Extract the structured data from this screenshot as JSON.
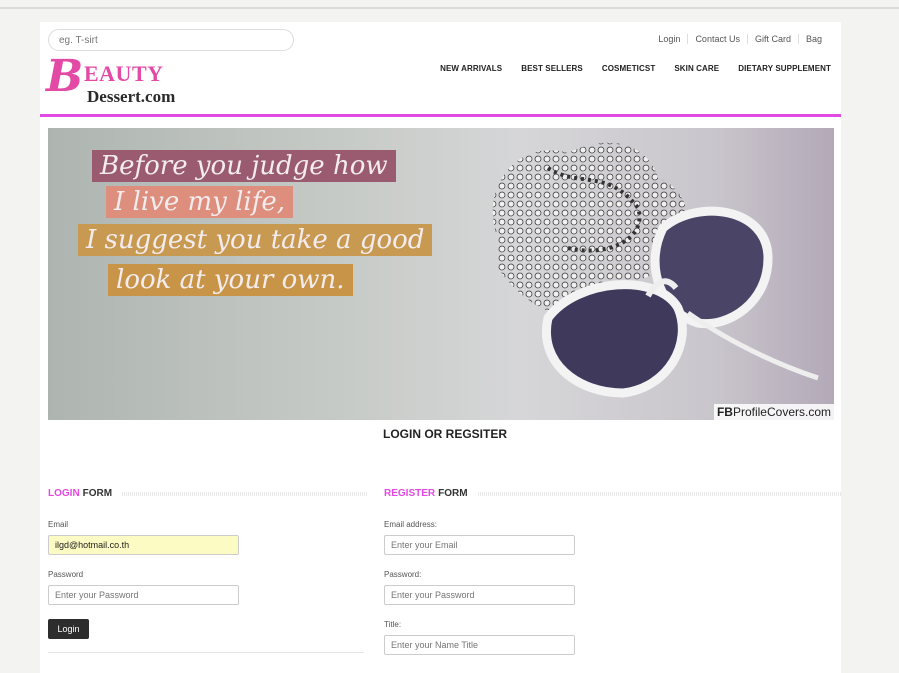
{
  "header": {
    "search_placeholder": "eg. T-sirt",
    "top_links": [
      "Login",
      "Contact Us",
      "Gift Card",
      "Bag"
    ]
  },
  "logo": {
    "initial": "B",
    "rest": "EAUTY",
    "sub": "Dessert.com"
  },
  "nav": [
    "NEW ARRIVALS",
    "BEST SELLERS",
    "COSMETICST",
    "SKIN CARE",
    "DIETARY SUPPLEMENT"
  ],
  "banner": {
    "lines": [
      "Before you judge how",
      "I live my life,",
      "I suggest you take a good",
      "look at your own."
    ],
    "credit_bold": "FB",
    "credit_rest": "ProfileCovers.com"
  },
  "page_title": "LOGIN OR REGSITER",
  "login_form": {
    "title_accent": "LOGIN",
    "title_rest": "FORM",
    "email_label": "Email",
    "email_value": "ilgd@hotmail.co.th",
    "password_label": "Password",
    "password_placeholder": "Enter your Password",
    "button": "Login"
  },
  "register_form": {
    "title_accent": "REGISTER",
    "title_rest": "FORM",
    "email_label": "Email address:",
    "email_placeholder": "Enter your Email",
    "password_label": "Password:",
    "password_placeholder": "Enter your Password",
    "title_label": "Title:",
    "title_placeholder": "Enter your Name Title"
  },
  "colors": {
    "accent": "#e34ae3",
    "logo_pink": "#e34aa6",
    "button": "#2d2d2d"
  }
}
